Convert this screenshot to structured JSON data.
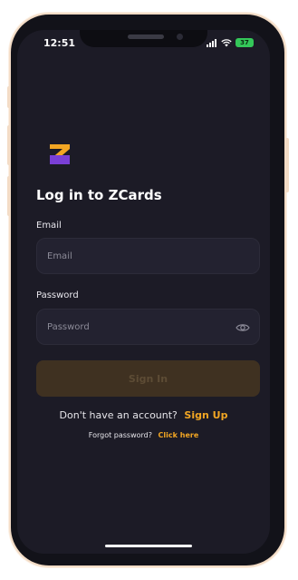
{
  "status": {
    "time": "12:51",
    "battery": "37"
  },
  "page": {
    "title": "Log in to ZCards"
  },
  "form": {
    "email_label": "Email",
    "email_placeholder": "Email",
    "password_label": "Password",
    "password_placeholder": "Password",
    "signin_label": "Sign In"
  },
  "footer": {
    "signup_prompt": "Don't have an account?",
    "signup_link": "Sign Up",
    "forgot_prompt": "Forgot password?",
    "forgot_link": "Click here"
  },
  "colors": {
    "accent": "#f2a623",
    "logo_top": "#f2a623",
    "logo_bottom": "#7a3fd6",
    "background": "#1c1b26"
  }
}
